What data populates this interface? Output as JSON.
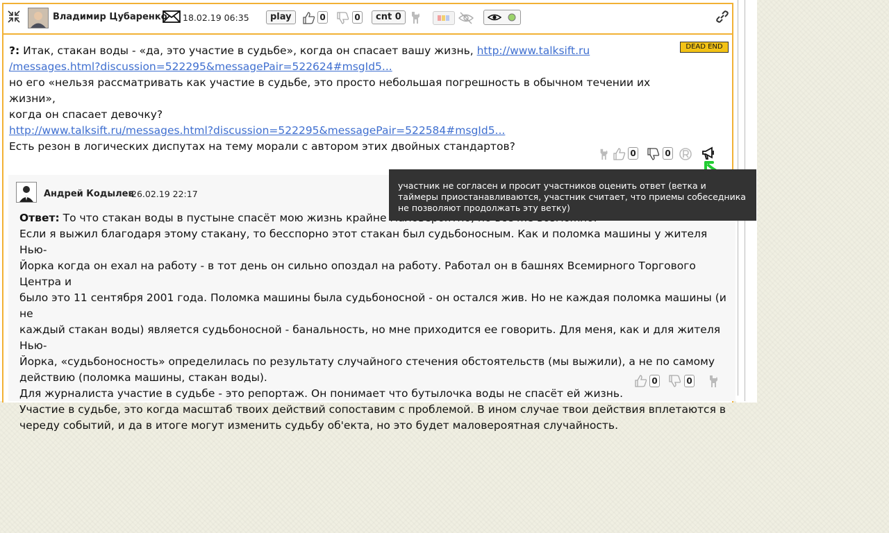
{
  "post": {
    "author": "Владимир Цубаренко",
    "date": "18.02.19 06:35",
    "play_label": "play",
    "likes": "0",
    "dislikes": "0",
    "cnt_label": "cnt 0",
    "badge": "DEAD END",
    "label": "?:",
    "line1": "Итак, стакан воды - «да, это участие в судьбе», когда он спасает вашу жизнь, ",
    "link1a": "http://www.talksift.ru",
    "link1b": "/messages.html?discussion=522295&messagePair=522624#msgId5...",
    "line2": "но его «нельзя рассматривать как участие в судьбе, это просто небольшая погрешность в обычном течении их жизни»,",
    "line3": "когда он спасает девочку?",
    "link2": "http://www.talksift.ru/messages.html?discussion=522295&messagePair=522584#msgId5...",
    "line4": "Есть резон в логических диспутах на тему морали с автором этих двойных стандартов?",
    "footer_likes": "0",
    "footer_dislikes": "0"
  },
  "tooltip": {
    "text": "участник не согласен и просит участников оценить ответ (ветка и таймеры приостанавливаются, участник считает, что приемы собеседника не позволяют продолжать эту ветку)"
  },
  "reply": {
    "author": "Андрей Кодылев",
    "date": "26.02.19 22:17",
    "label": "Ответ:",
    "lines": [
      " То что стакан воды в пустыне спасёт мою жизнь крайне маловероятно, но всё же возможно.",
      "Если я выжил благодаря этому стакану, то бесспорно этот стакан был судьбоносным. Как и поломка машины у жителя Нью-",
      "Йорка когда он ехал на работу - в тот день он сильно опоздал на работу. Работал он в башнях Всемирного Торгового Центра и",
      "было это 11 сентября 2001 года. Поломка машины была судьбоносной - он остался жив. Но не каждая поломка машины (и не",
      "каждый стакан воды) является судьбоносной - банальность, но мне приходится ее говорить. Для меня, как и для жителя Нью-",
      "Йорка, «судьбоносность» определилась по результату случайного стечения обстоятельств (мы выжили), а не по самому",
      "действию (поломка машины, стакан воды).",
      "Для журналиста участие в судьбе - это репортаж. Он понимает что бутылочка воды не спасёт ей жизнь.",
      "Участие в судьбе, это когда масштаб твоих действий сопоставим с проблемой. В ином случае твои действия вплетаются в",
      "череду событий, и да в итоге могут изменить судьбу об'екта, но это будет маловероятная случайность."
    ],
    "likes": "0",
    "dislikes": "0"
  },
  "colors": {
    "accent_border": "#f2b134",
    "link": "#3f6fd0",
    "badge": "#f2c216",
    "annotation_arrow": "#22cc33"
  }
}
